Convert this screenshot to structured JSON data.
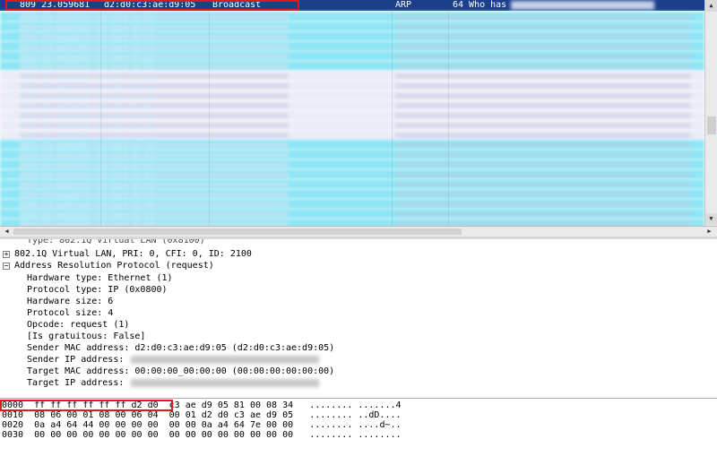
{
  "packet_list": {
    "selected_row": {
      "no": "809",
      "time": "23.059681",
      "source": "d2:d0:c3:ae:d9:05",
      "destination": "Broadcast",
      "protocol": "ARP",
      "info": "64 Who has"
    },
    "blurred_rows": [
      {
        "c1": "810 23.060112  10.104.0.22",
        "c2": "ARP   10.104.0.1",
        "style": "cyan"
      },
      {
        "c1": "811 23.060400  10.104.0.23",
        "c2": "ARP   10.104.0.1",
        "style": "cyan"
      },
      {
        "c1": "812 23.060871  10.104.0.24",
        "c2": "ARP   10.104.0.1",
        "style": "cyan"
      },
      {
        "c1": "813 23.061245  10.104.0.25",
        "c2": "ARP   10.104.0.1",
        "style": "cyan"
      },
      {
        "c1": "814 23.061602  10.104.0.26",
        "c2": "ARP   10.104.0.1",
        "style": "cyan"
      },
      {
        "c1": "815 23.062001  10.104.0.27",
        "c2": "ARP   10.104.0.1",
        "style": "cyan"
      },
      {
        "c1": "816 23.062390  d2:d0:c3:ae",
        "c2": "ARP   Who has",
        "style": "lav"
      },
      {
        "c1": "817 23.062771  d2:d0:c3:ae",
        "c2": "ARP   Who has",
        "style": "lav"
      },
      {
        "c1": "818 23.063100  d2:d0:c3:ae",
        "c2": "ARP   Who has",
        "style": "lav"
      },
      {
        "c1": "819 23.063480  d2:d0:c3:ae",
        "c2": "ARP   Who has",
        "style": "lav"
      },
      {
        "c1": "820 23.063861  d2:d0:c3:ae",
        "c2": "ARP   Who has",
        "style": "lav"
      },
      {
        "c1": "821 23.064240  d2:d0:c3:ae",
        "c2": "ARP   Who has",
        "style": "lav"
      },
      {
        "c1": "822 23.064622  d2:d0:c3:ae",
        "c2": "ARP   Who has",
        "style": "lav"
      },
      {
        "c1": "823 23.065001  10.104.0.30",
        "c2": "ARP   10.104.0.1",
        "style": "cyan"
      },
      {
        "c1": "824 23.065380  10.104.0.31",
        "c2": "ARP   10.104.0.1",
        "style": "cyan"
      },
      {
        "c1": "825 23.065761  10.104.0.32",
        "c2": "ARP   10.104.0.1",
        "style": "cyan"
      },
      {
        "c1": "826 23.066140  10.104.0.33",
        "c2": "ARP   10.104.0.1",
        "style": "cyan"
      },
      {
        "c1": "827 23.066520  10.104.0.34",
        "c2": "ARP   10.104.0.1",
        "style": "cyan"
      },
      {
        "c1": "828 23.066901  10.104.0.35",
        "c2": "ARP   10.104.0.1",
        "style": "cyan"
      },
      {
        "c1": "829 23.067280  10.104.0.36",
        "c2": "ARP   10.104.0.1",
        "style": "cyan"
      },
      {
        "c1": "830 23.067661  10.104.0.37",
        "c2": "ARP   10.104.0.1",
        "style": "cyan"
      },
      {
        "c1": "831 23.068040  10.104.0.38",
        "c2": "ARP   10.104.0.1",
        "style": "cyan"
      }
    ]
  },
  "details": {
    "cut_line": "Type: 802.1Q Virtual LAN (0x8100)",
    "vlan": "802.1Q Virtual LAN, PRI: 0, CFI: 0, ID: 2100",
    "arp_header": "Address Resolution Protocol (request)",
    "hw_type": "Hardware type: Ethernet (1)",
    "proto_type": "Protocol type: IP (0x0800)",
    "hw_size": "Hardware size: 6",
    "proto_size": "Protocol size: 4",
    "opcode": "Opcode: request (1)",
    "gratuitous": "[Is gratuitous: False]",
    "sender_mac": "Sender MAC address: d2:d0:c3:ae:d9:05 (d2:d0:c3:ae:d9:05)",
    "sender_ip": "Sender IP address:",
    "target_mac": "Target MAC address: 00:00:00_00:00:00 (00:00:00:00:00:00)",
    "target_ip": "Target IP address:"
  },
  "hex": {
    "lines": [
      {
        "offset": "0000",
        "bytes": "ff ff ff ff ff ff d2 d0  c3 ae d9 05 81 00 08 34",
        "ascii": "........ .......4"
      },
      {
        "offset": "0010",
        "bytes": "08 06 00 01 08 00 06 04  00 01 d2 d0 c3 ae d9 05",
        "ascii": "........ ..dD...."
      },
      {
        "offset": "0020",
        "bytes": "0a a4 64 44 00 00 00 00  00 00 0a a4 64 7e 00 00",
        "ascii": "........ ....d~.."
      },
      {
        "offset": "0030",
        "bytes": "00 00 00 00 00 00 00 00  00 00 00 00 00 00 00 00",
        "ascii": "........ ........"
      }
    ]
  },
  "icons": {
    "tree_expanded": "⊟",
    "tree_collapsed": "⊞",
    "scroll_up": "▲",
    "scroll_down": "▼",
    "scroll_left": "◀",
    "scroll_right": "▶"
  },
  "colors": {
    "selected_row": "#1c3f8c",
    "row_cyan": "#8ee6f5",
    "row_lavender": "#ececf8",
    "annotation_red": "#e01818"
  }
}
